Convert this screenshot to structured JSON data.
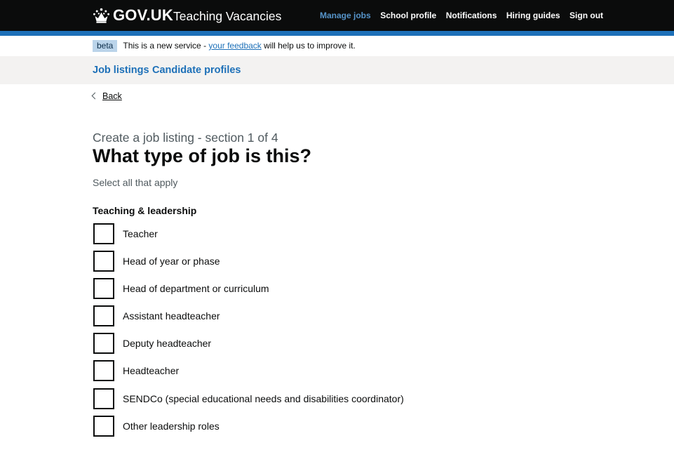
{
  "header": {
    "logo_text": "GOV.UK",
    "service_name": "Teaching Vacancies",
    "nav": [
      {
        "label": "Manage jobs",
        "active": true
      },
      {
        "label": "School profile",
        "active": false
      },
      {
        "label": "Notifications",
        "active": false
      },
      {
        "label": "Hiring guides",
        "active": false
      },
      {
        "label": "Sign out",
        "active": false
      }
    ]
  },
  "phase_banner": {
    "tag": "beta",
    "text_before": "This is a new service - ",
    "link": "your feedback",
    "text_after": " will help us to improve it."
  },
  "subnav": {
    "items": [
      "Job listings",
      "Candidate profiles"
    ]
  },
  "back_link": "Back",
  "form": {
    "caption": "Create a job listing - section 1 of 4",
    "title": "What type of job is this?",
    "hint": "Select all that apply",
    "legend": "Teaching & leadership",
    "options": [
      {
        "label": "Teacher",
        "checked": false
      },
      {
        "label": "Head of year or phase",
        "checked": false
      },
      {
        "label": "Head of department or curriculum",
        "checked": false
      },
      {
        "label": "Assistant headteacher",
        "checked": false
      },
      {
        "label": "Deputy headteacher",
        "checked": false
      },
      {
        "label": "Headteacher",
        "checked": false
      },
      {
        "label": "SENDCo (special educational needs and disabilities coordinator)",
        "checked": false
      },
      {
        "label": "Other leadership roles",
        "checked": false
      }
    ]
  },
  "icons": {
    "logo": "crown-icon",
    "back": "chevron-left-icon"
  },
  "colors": {
    "header_bg": "#0b0c0c",
    "brand_blue": "#1d70b8",
    "active_nav": "#5694ca",
    "beta_tag_bg": "#bbd4ea",
    "subnav_bg": "#f3f2f1",
    "secondary_text": "#505a5f"
  }
}
